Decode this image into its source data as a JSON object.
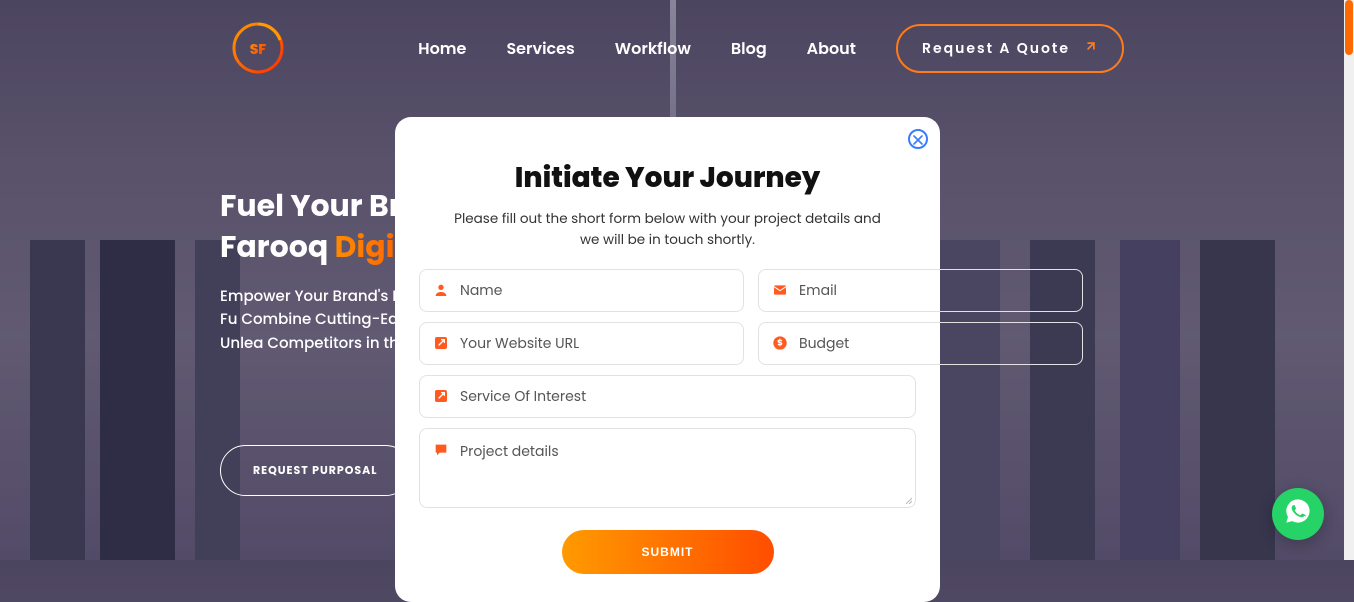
{
  "nav": {
    "items": [
      "Home",
      "Services",
      "Workflow",
      "Blog",
      "About"
    ],
    "cta": "Request A Quote"
  },
  "hero": {
    "title_line1": "Fuel Your Brand",
    "title_line2_plain": "Farooq ",
    "title_line2_gradient": "Digital",
    "paragraph": "Empower Your Brand's Marketing Agency. From SEM Campaigns, We Fu Combine Cutting-Edge Brand's Visibility, Drive Partner with Us to Unlea Competitors in the Dus",
    "button": "REQUEST PURPOSAL"
  },
  "modal": {
    "title": "Initiate Your Journey",
    "subtitle": "Please fill out the short form below with your project details and we will be in touch shortly.",
    "fields": {
      "name": "Name",
      "email": "Email",
      "url": "Your Website URL",
      "budget": "Budget",
      "service": "Service Of Interest",
      "details": "Project details"
    },
    "submit": "SUBMIT"
  }
}
